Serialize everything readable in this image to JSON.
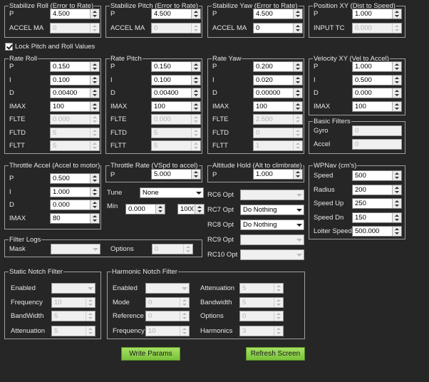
{
  "stabilize_roll": {
    "title": "Stabilize Roll (Error to Rate)",
    "p_label": "P",
    "p": "4.500",
    "accel_label": "ACCEL MA",
    "accel": "0"
  },
  "stabilize_pitch": {
    "title": "Stabilize Pitch (Error to Rate)",
    "p_label": "P",
    "p": "4.500",
    "accel_label": "ACCEL MA",
    "accel": "0"
  },
  "stabilize_yaw": {
    "title": "Stabilize Yaw (Error to Rate)",
    "p_label": "P",
    "p": "4.500",
    "accel_label": "ACCEL MA",
    "accel": "0"
  },
  "position_xy": {
    "title": "Position XY (Dist to Speed)",
    "p_label": "P",
    "p": "1.000",
    "input_label": "INPUT TC",
    "input": "0.000"
  },
  "lock_pitch_roll": {
    "label": "Lock Pitch and Roll Values",
    "checked": true
  },
  "rate_roll": {
    "title": "Rate Roll",
    "labels": [
      "P",
      "I",
      "D",
      "IMAX",
      "FLTE",
      "FLTD",
      "FLTT"
    ],
    "values": [
      "0.150",
      "0.100",
      "0.00400",
      "100",
      "0.000",
      "5",
      "5"
    ]
  },
  "rate_pitch": {
    "title": "Rate Pitch",
    "labels": [
      "P",
      "I",
      "D",
      "IMAX",
      "FLTE",
      "FLTD",
      "FLTT"
    ],
    "values": [
      "0.150",
      "0.100",
      "0.00400",
      "100",
      "0.000",
      "5",
      "5"
    ]
  },
  "rate_yaw": {
    "title": "Rate Yaw",
    "labels": [
      "P",
      "I",
      "D",
      "IMAX",
      "FLTE",
      "FLTD",
      "FLTT"
    ],
    "values": [
      "0.200",
      "0.020",
      "0.00000",
      "100",
      "2.500",
      "0",
      "1"
    ]
  },
  "velocity_xy": {
    "title": "Velocity XY (Vel to Accel)",
    "labels": [
      "P",
      "I",
      "D",
      "IMAX"
    ],
    "values": [
      "1.000",
      "0.500",
      "0.000",
      "100"
    ]
  },
  "basic_filters": {
    "title": "Basic Filters",
    "gyro_label": "Gyro",
    "gyro": "0",
    "accel_label": "Accel",
    "accel": "0"
  },
  "throttle_accel": {
    "title": "Throttle Accel (Accel to motor)",
    "labels": [
      "P",
      "I",
      "D",
      "IMAX"
    ],
    "values": [
      "0.500",
      "1.000",
      "0.000",
      "80"
    ]
  },
  "throttle_rate": {
    "title": "Throttle Rate (VSpd to accel)",
    "p_label": "P",
    "p": "5.000"
  },
  "altitude_hold": {
    "title": "Altitude Hold (Alt to climbrate)",
    "p_label": "P",
    "p": "1.000"
  },
  "tune": {
    "label": "Tune",
    "value": "None",
    "min_label": "Min",
    "min": "0.000",
    "max": "1000"
  },
  "rc_opts": [
    {
      "label": "RC6 Opt",
      "value": ""
    },
    {
      "label": "RC7 Opt",
      "value": "Do Nothing"
    },
    {
      "label": "RC8 Opt",
      "value": "Do Nothing"
    },
    {
      "label": "RC9 Opt",
      "value": ""
    },
    {
      "label": "RC10 Opt",
      "value": ""
    }
  ],
  "wpnav": {
    "title": "WPNav (cm's)",
    "labels": [
      "Speed",
      "Radius",
      "Speed Up",
      "Speed Dn",
      "Loiter Speed"
    ],
    "values": [
      "500",
      "200",
      "250",
      "150",
      "500.000"
    ]
  },
  "filter_logs": {
    "title": "Filter Logs",
    "mask_label": "Mask",
    "options_label": "Options",
    "options": "0"
  },
  "static_notch": {
    "title": "Static Notch Filter",
    "enabled_label": "Enabled",
    "frequency_label": "Frequency",
    "frequency": "10",
    "bandwidth_label": "BandWidth",
    "bandwidth": "5",
    "attenuation_label": "Attenuation",
    "attenuation": "5"
  },
  "harmonic_notch": {
    "title": "Harmonic Notch Filter",
    "enabled_label": "Enabled",
    "mode_label": "Mode",
    "mode": "0",
    "reference_label": "Reference",
    "reference": "0",
    "frequency_label": "Frequency",
    "frequency": "10",
    "attenuation_label": "Attenuation",
    "attenuation": "5",
    "bandwidth_label": "Bandwidth",
    "bandwidth": "5",
    "options_label": "Options",
    "options": "0",
    "harmonics_label": "Harmonics",
    "harmonics": "3"
  },
  "buttons": {
    "write_params": "Write Params",
    "refresh_screen": "Refresh Screen"
  },
  "colors": {
    "background": "#262626",
    "button": "#8fd14f",
    "group_border": "#a0a0a0"
  }
}
